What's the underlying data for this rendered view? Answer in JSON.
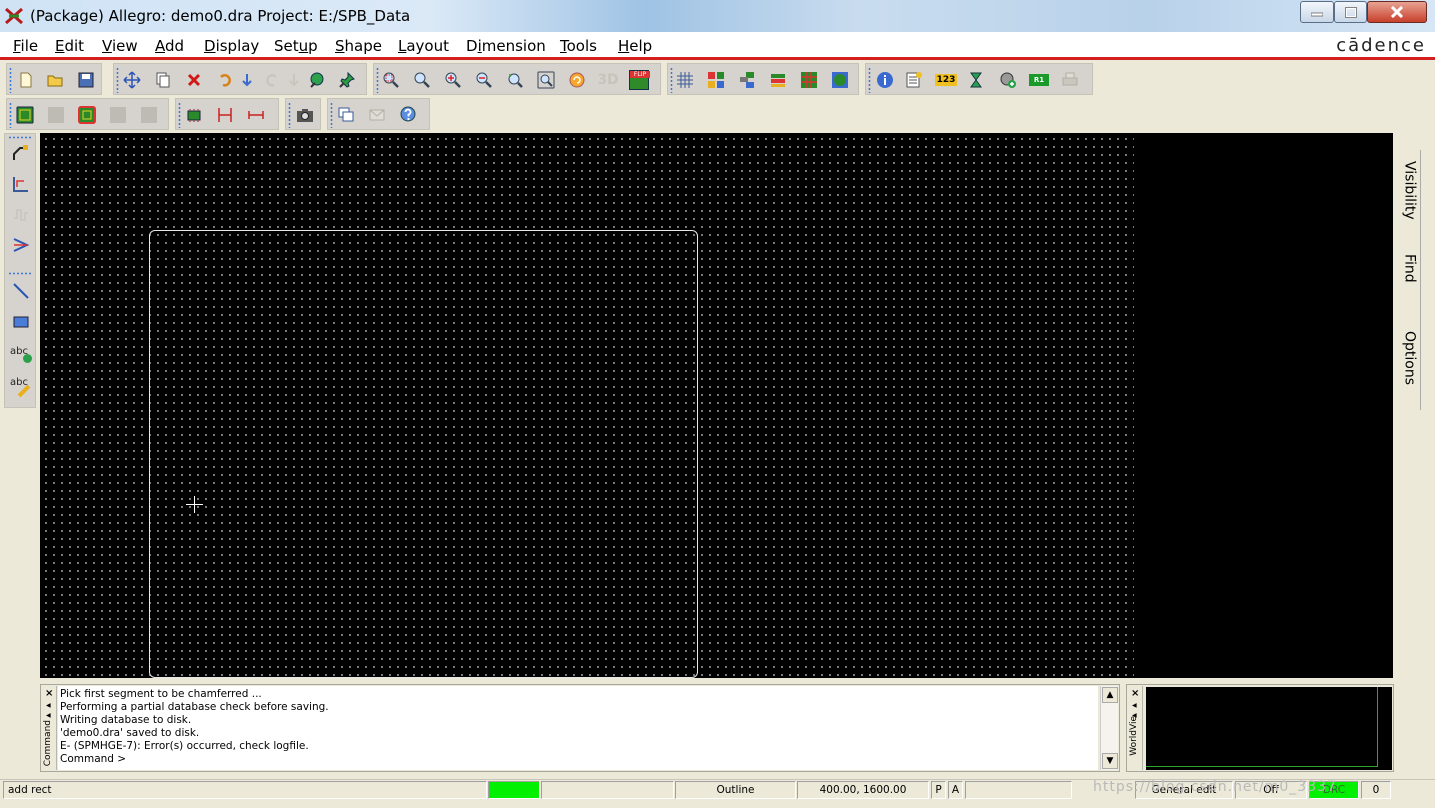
{
  "window": {
    "title": "(Package) Allegro: demo0.dra  Project: E:/SPB_Data",
    "icons": [
      "app-icon",
      "minimize-icon",
      "maximize-icon",
      "close-icon"
    ]
  },
  "menu": {
    "items": [
      {
        "label": "File",
        "key": "F"
      },
      {
        "label": "Edit",
        "key": "E"
      },
      {
        "label": "View",
        "key": "V"
      },
      {
        "label": "Add",
        "key": "A"
      },
      {
        "label": "Display",
        "key": "D"
      },
      {
        "label": "Setup",
        "key": "u"
      },
      {
        "label": "Shape",
        "key": "S"
      },
      {
        "label": "Layout",
        "key": "L"
      },
      {
        "label": "Dimension",
        "key": "i"
      },
      {
        "label": "Tools",
        "key": "T"
      },
      {
        "label": "Help",
        "key": "H"
      }
    ],
    "brand": "cādence"
  },
  "toolbar1": {
    "icons": [
      "new-icon",
      "open-icon",
      "save-icon",
      "move-icon",
      "copy-icon",
      "delete-icon",
      "undo-icon",
      "undo-arrow-icon",
      "redo-icon",
      "redo-arrow-icon",
      "pin-green-icon",
      "pushpin-icon",
      "zoom-points-icon",
      "zoom-fit-icon",
      "zoom-in-icon",
      "zoom-out-icon",
      "zoom-previous-icon",
      "zoom-world-icon",
      "redraw-icon",
      "view-3d-icon",
      "flip-icon",
      "grid-icon",
      "color-icon",
      "layers-icon",
      "shadow-icon",
      "palette-icon",
      "globe-icon",
      "info-icon",
      "report-icon",
      "measure-icon",
      "hourglass-icon",
      "add-icon",
      "ref-des-icon",
      "printer-icon"
    ],
    "flip_label": "FLIP",
    "view3d_label": "3D",
    "measure_label": "123",
    "ref_label": "R1"
  },
  "toolbar2": {
    "icons": [
      "board-icon",
      "board-disabled-icon",
      "board-outline-icon",
      "board-disabled-2-icon",
      "board-disabled-3-icon",
      "component-icon",
      "dimension-linear-icon",
      "dimension-span-icon",
      "camera-icon",
      "windows-icon",
      "mail-icon",
      "help-icon"
    ]
  },
  "left_toolbar": {
    "icons": [
      "chamfer-icon",
      "fillet-icon",
      "wave-icon",
      "arrow-icon",
      "line-icon",
      "rectangle-icon",
      "add-text-icon",
      "edit-text-icon"
    ],
    "text_icon_label": "abc"
  },
  "right_tabs": [
    "Visibility",
    "Find",
    "Options"
  ],
  "command_panel": {
    "label": "Command",
    "lines": [
      "Pick first segment to be chamferred ...",
      "Performing a partial database check before saving.",
      "Writing database to disk.",
      "'demo0.dra' saved to disk.",
      "E- (SPMHGE-7): Error(s) occurred, check logfile.",
      "Command >"
    ]
  },
  "worldview": {
    "label": "WorldVie"
  },
  "status": {
    "command": "add rect",
    "mode": "Outline",
    "coords": "400.00, 1600.00",
    "p_label": "P",
    "a_label": "A",
    "edit_mode": "General edit",
    "off_label": "Off",
    "drc_label": "DRC",
    "count": "0",
    "progress_color": "#00f000"
  },
  "watermark": "https://blog.csdn.net/m0_3337"
}
